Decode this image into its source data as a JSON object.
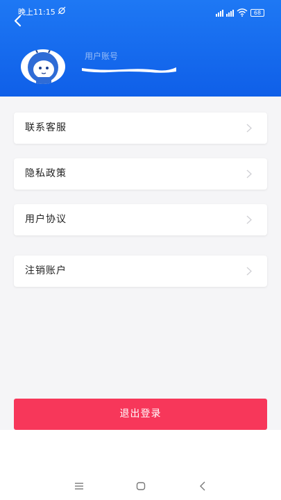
{
  "status_bar": {
    "time": "晚上11:15",
    "battery": "68"
  },
  "header": {
    "account_label": "用户账号",
    "back_icon": "chevron-left-icon"
  },
  "menu": {
    "items": [
      {
        "label": "联系客服"
      },
      {
        "label": "隐私政策"
      },
      {
        "label": "用户协议"
      },
      {
        "label": "注销账户"
      }
    ]
  },
  "logout": {
    "label": "退出登录"
  },
  "colors": {
    "header_blue": "#1e78f4",
    "logout_red": "#f7375a",
    "background": "#f5f5f7"
  },
  "nav": {
    "icons": [
      "menu-icon",
      "home-icon",
      "back-icon"
    ]
  }
}
